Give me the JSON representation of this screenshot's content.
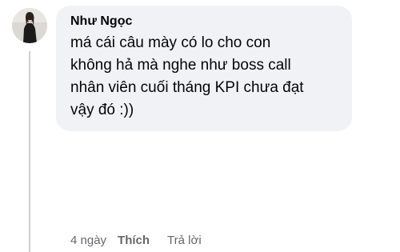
{
  "comment": {
    "author": "Như Ngọc",
    "text": "má cái câu mày có lo cho con\nkhông hả mà nghe như boss call\nnhân viên cuối tháng KPI chưa đạt\nvậy đó :))",
    "avatar_icon": "user-profile-photo"
  },
  "actions": {
    "time": "4 ngày",
    "like_label": "Thích",
    "reply_label": "Trả lời"
  },
  "colors": {
    "bubble_background": "#f0f2f5",
    "thread_line": "#ced0d4",
    "secondary_text": "#65676b",
    "primary_text": "#050505"
  }
}
